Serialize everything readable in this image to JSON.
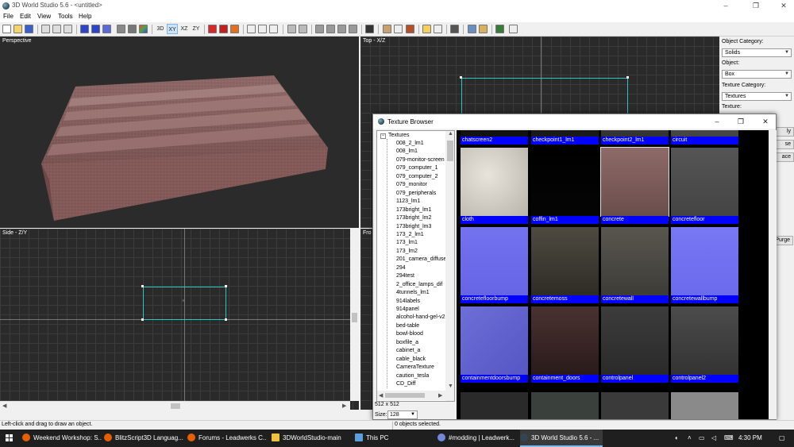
{
  "window": {
    "title": "3D World Studio 5.6 - <untitled>",
    "min": "–",
    "max": "❐",
    "close": "✕"
  },
  "menu": [
    "File",
    "Edit",
    "View",
    "Tools",
    "Help"
  ],
  "toolbar": {
    "view_buttons": [
      "3D",
      "XY",
      "XZ",
      "ZY"
    ]
  },
  "viewports": {
    "perspective": "Perspective",
    "top": "Top - X/Z",
    "side": "Side - Z/Y",
    "front": "Fro"
  },
  "side_panel": {
    "object_category_label": "Object Category:",
    "object_category_value": "Solids",
    "object_label": "Object:",
    "object_value": "Box",
    "texture_category_label": "Texture Category:",
    "texture_category_value": "Textures",
    "texture_label": "Texture:",
    "btn_apply": "ly",
    "btn_browse": "se",
    "btn_replace": "ace",
    "btn_purge": "Purge"
  },
  "texture_browser": {
    "title": "Texture Browser",
    "tree_root": "Textures",
    "tree_items": [
      "008_2_lm1",
      "008_lm1",
      "079-monitor-screen",
      "079_computer_1",
      "079_computer_2",
      "079_monitor",
      "079_peripherals",
      "1123_lm1",
      "173bright_lm1",
      "173bright_lm2",
      "173bright_lm3",
      "173_2_lm1",
      "173_lm1",
      "173_lm2",
      "201_camera_diffuse",
      "294",
      "294test",
      "2_office_lamps_dif",
      "4tunnels_lm1",
      "914labels",
      "914panel",
      "alcohol-hand-gel-v2-",
      "bed-table",
      "bowl-blood",
      "boxfile_a",
      "cabinet_a",
      "cable_black",
      "CameraTexture",
      "caution_tesla",
      "CD_Diff"
    ],
    "resolution": "512 x 512",
    "size_label": "Size:",
    "size_value": "128",
    "rows": [
      [
        "chatscreen2",
        "checkpoint1_lm1",
        "checkpoint2_lm1",
        "circuit"
      ],
      [
        "cloth",
        "coffin_lm1",
        "concrete",
        "concretefloor"
      ],
      [
        "concretefloorbump",
        "concretemoss",
        "concretewall",
        "concretewallbump"
      ],
      [
        "containmentdoorsbump",
        "containment_doors",
        "controlpanel",
        "controlpanel2"
      ]
    ],
    "selected": "concrete"
  },
  "status": {
    "left": "Left-click and drag to draw an object.",
    "right": "0 objects selected."
  },
  "taskbar": {
    "items": [
      "Weekend Workshop: S...",
      "BlitzScript3D Languag...",
      "Forums - Leadwerks C...",
      "3DWorldStudio-main",
      "This PC",
      "#modding | Leadwerk...",
      "3D World Studio 5.6 - ..."
    ],
    "clock": "4:30 PM"
  },
  "colors": {
    "viewport_bg": "#2a2a2a",
    "selection_cyan": "#2ec4c4",
    "label_blue": "#0000ff",
    "brick": "#8a5a58"
  }
}
